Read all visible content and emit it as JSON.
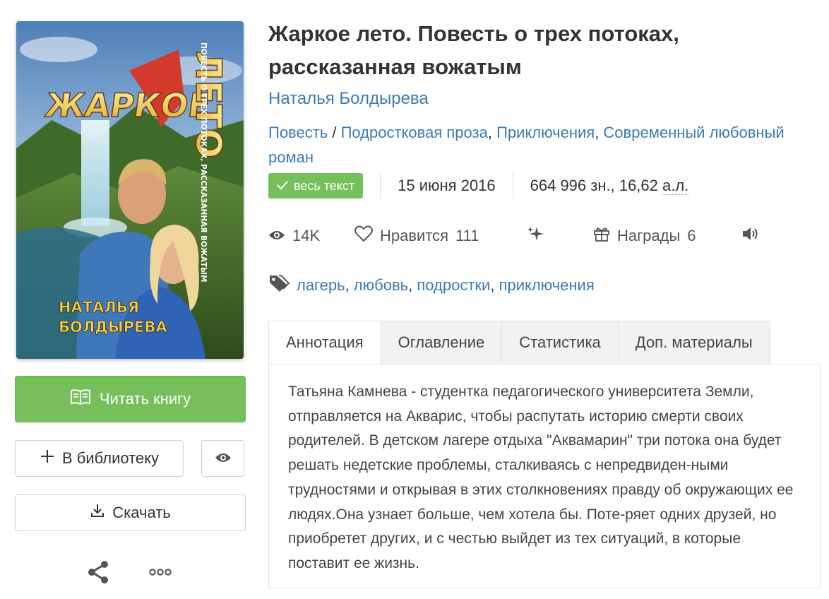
{
  "book": {
    "title": "Жаркое лето. Повесть о трех потоках, рассказанная вожатым",
    "author": "Наталья Болдырева",
    "cover": {
      "title_word_1": "ЖАРКОЕ",
      "title_word_2": "ЛЕТО",
      "subtitle": "ПОВЕСТЬ О ТРЁХ ПОТОКАХ, РАССКАЗАННАЯ ВОЖАТЫМ",
      "author_line_1": "НАТАЛЬЯ",
      "author_line_2": "БОЛДЫРЕВА"
    }
  },
  "genres": {
    "category": "Повесть",
    "separator": " / ",
    "items": [
      "Подростковая проза",
      "Приключения",
      "Современный любовный роман"
    ]
  },
  "meta": {
    "badge": "весь текст",
    "date": "15 июня 2016",
    "size_prefix": "664 996 зн., 16,62 ",
    "size_unit": "а.л."
  },
  "stats": {
    "views": "14K",
    "likes_label": "Нравится",
    "likes_count": "111",
    "awards_label": "Награды",
    "awards_count": "6"
  },
  "tags": [
    "лагерь",
    "любовь",
    "подростки",
    "приключения"
  ],
  "tabs": [
    "Аннотация",
    "Оглавление",
    "Статистика",
    "Доп. материалы"
  ],
  "annotation": "Татьяна Камнева - студентка педагогического университета Земли, отправляется на Акварис, чтобы распутать историю смерти своих родителей. В детском лагере отдыха \"Аквамарин\" три потока она будет решать недетские проблемы, сталкиваясь с непредвиден-ными трудностями и открывая в этих столкновениях правду об окружающих ее людях.Она узнает больше, чем хотела бы. Поте-ряет одних друзей, но приобретет других, и с честью выйдет из тех ситуаций, в которые поставит ее жизнь.",
  "buttons": {
    "read": "Читать книгу",
    "library": "В библиотеку",
    "download": "Скачать"
  },
  "colors": {
    "accent_green": "#76bf5a",
    "link_blue": "#3d7ab3"
  }
}
